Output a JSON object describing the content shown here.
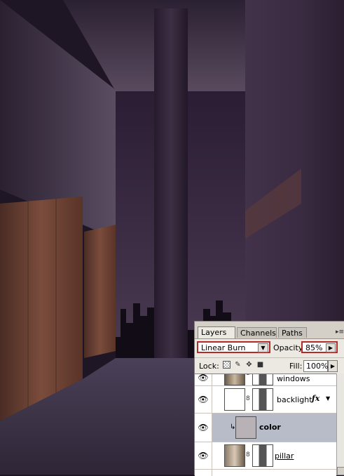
{
  "layers_panel": {
    "tabs": [
      "Layers",
      "Channels",
      "Paths"
    ],
    "active_tab": "Layers",
    "panel_menu_icon": "panel-menu-icon",
    "blend_mode": "Linear Burn",
    "opacity_label": "Opacity:",
    "opacity_value": "85%",
    "lock_label": "Lock:",
    "lock_icons": [
      "lock-transparent-icon",
      "lock-paint-icon",
      "lock-move-icon",
      "lock-all-icon"
    ],
    "fill_label": "Fill:",
    "fill_value": "100%",
    "layers": [
      {
        "name": "windows",
        "visible": true,
        "selected": false,
        "has_mask": true,
        "fx": false
      },
      {
        "name": "backlight",
        "visible": true,
        "selected": false,
        "has_mask": true,
        "fx": true
      },
      {
        "name": "color",
        "visible": true,
        "selected": true,
        "has_mask": false,
        "fx": false,
        "clipped": true
      },
      {
        "name": "pillar",
        "visible": true,
        "selected": false,
        "has_mask": true,
        "fx": false
      }
    ]
  },
  "colors": {
    "panel_bg": "#d4d0c8",
    "selected_row": "#b7bcc8",
    "highlight_border": "#b22b2b",
    "scene_shadow": "#1e1624"
  }
}
